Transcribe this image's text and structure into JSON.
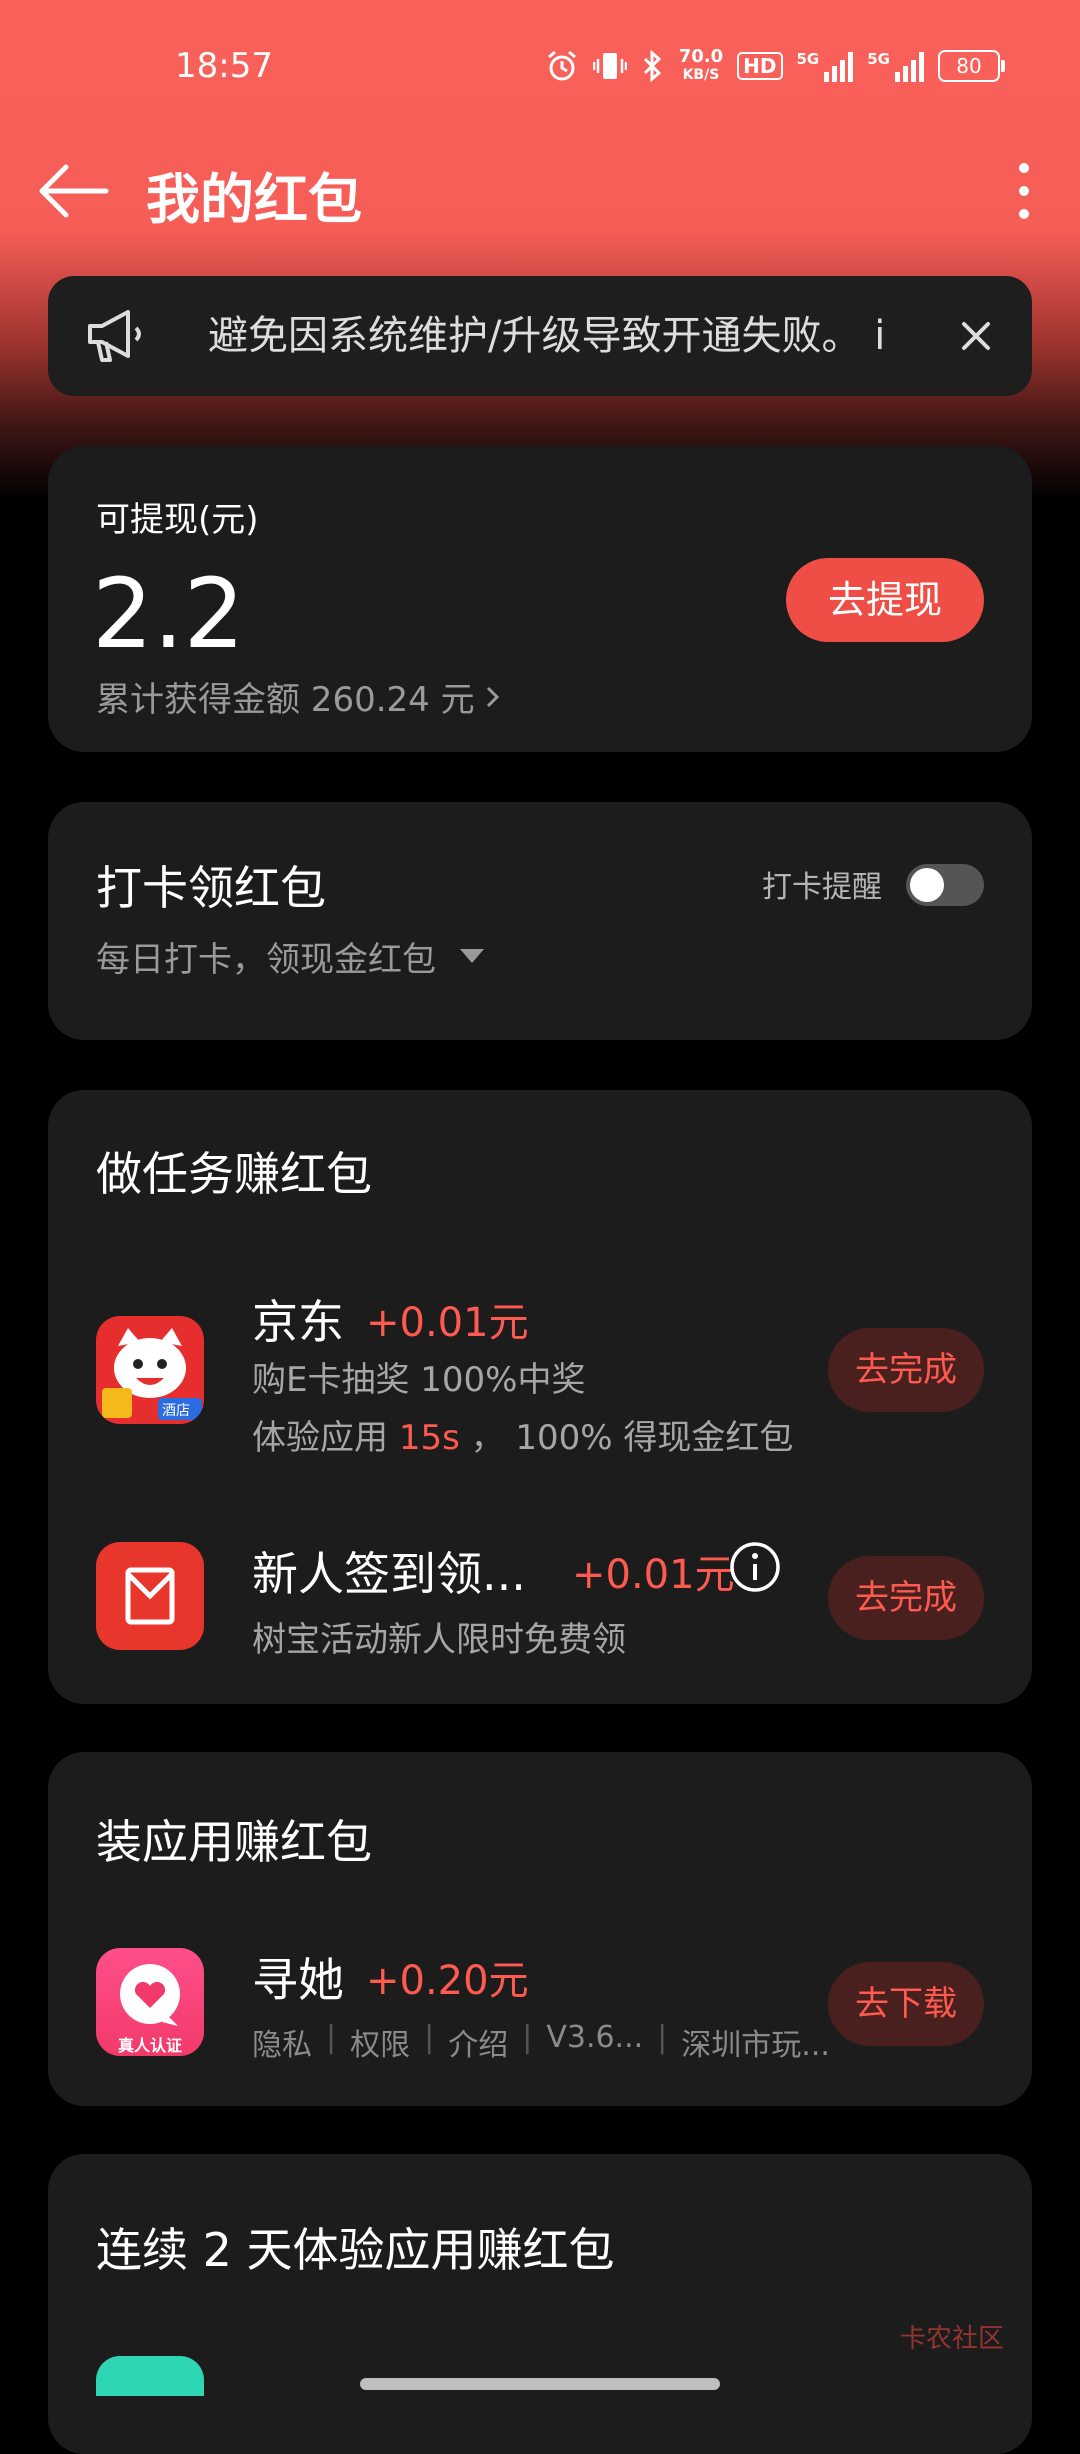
{
  "status": {
    "time": "18:57",
    "net_speed_value": "70.0",
    "net_speed_unit": "KB/S",
    "hd": "HD",
    "sim1": "5G",
    "sim2": "5G",
    "battery": "80"
  },
  "appbar": {
    "title": "我的红包"
  },
  "notice": {
    "text": "避免因系统维护/升级导致开通失败。 i"
  },
  "balance": {
    "label": "可提现(元)",
    "amount": "2.2",
    "cumulative": "累计获得金额 260.24 元",
    "withdraw_btn": "去提现"
  },
  "checkin": {
    "title": "打卡领红包",
    "subtitle": "每日打卡，领现金红包",
    "reminder_label": "打卡提醒",
    "reminder_on": false
  },
  "tasks": {
    "title": "做任务赚红包",
    "items": [
      {
        "name": "京东",
        "reward": "+0.01元",
        "desc1": "购E卡抽奖 100%中奖",
        "desc2_prefix": "体验应用 ",
        "desc2_highlight": "15s",
        "desc2_suffix": " ， 100% 得现金红包",
        "icon_label": "酒店",
        "button": "去完成"
      },
      {
        "name": "新人签到领...",
        "reward": "+0.01元",
        "desc1": "树宝活动新人限时免费领",
        "button": "去完成"
      }
    ]
  },
  "apps": {
    "title": "装应用赚红包",
    "item": {
      "name": "寻她",
      "reward": "+0.20元",
      "meta": [
        "隐私",
        "权限",
        "介绍",
        "V3.6...",
        "深圳市玩..."
      ],
      "icon_label": "真人认证",
      "button": "去下载"
    }
  },
  "streak": {
    "title": "连续 2 天体验应用赚红包"
  },
  "watermark": "卡农社区"
}
